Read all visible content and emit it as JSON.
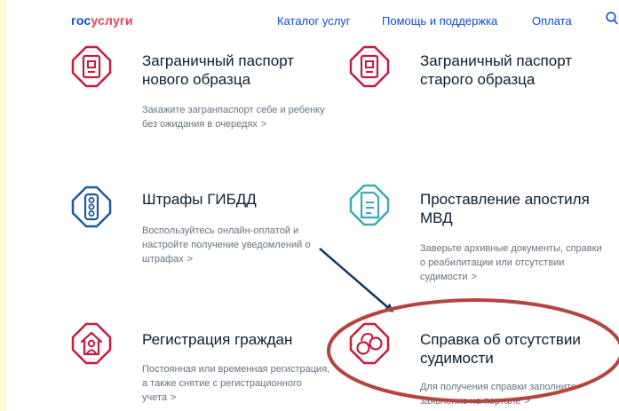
{
  "header": {
    "logo_part1": "гос",
    "logo_part2": "услуги",
    "nav": [
      "Каталог услуг",
      "Помощь и поддержка",
      "Оплата"
    ]
  },
  "cards": [
    {
      "title_lines": [
        "Заграничный паспорт",
        "нового образца"
      ],
      "desc_lines": [
        "Закажите загранпаспорт себе и ребенку",
        "без ожидания в очередях"
      ],
      "icon": "passport-icon"
    },
    {
      "title_lines": [
        "Заграничный паспорт",
        "старого образца"
      ],
      "desc_lines": [],
      "icon": "passport-icon"
    },
    {
      "title_lines": [
        "Штрафы ГИБДД"
      ],
      "desc_lines": [
        "Воспользуйтесь онлайн-оплатой и",
        "настройте получение уведомлений о",
        "штрафах"
      ],
      "icon": "traffic-light-icon"
    },
    {
      "title_lines": [
        "Проставление апостиля",
        "МВД"
      ],
      "desc_lines": [
        "Заверьте архивные документы, справки",
        "о реабилитации или отсутствии",
        "судимости"
      ],
      "icon": "document-icon"
    },
    {
      "title_lines": [
        "Регистрация граждан"
      ],
      "desc_lines": [
        "Постоянная или временная регистрация,",
        "а также снятие с регистрационного",
        "учета"
      ],
      "icon": "house-person-icon"
    },
    {
      "title_lines": [
        "Справка об отсутствии",
        "судимости"
      ],
      "desc_lines": [
        "Для получения справки заполните",
        "заявление на портале"
      ],
      "icon": "handcuffs-icon"
    }
  ],
  "chevron": ">",
  "colors": {
    "brand_blue": "#0d4cd3",
    "brand_red": "#ee3f58",
    "icon_red": "#c41c3c",
    "icon_blue": "#1e5a9e",
    "icon_teal": "#3aabb5",
    "annotation_ellipse": "#b5443e",
    "annotation_arrow": "#17365d",
    "highlight_yellow": "#fffdd8"
  }
}
